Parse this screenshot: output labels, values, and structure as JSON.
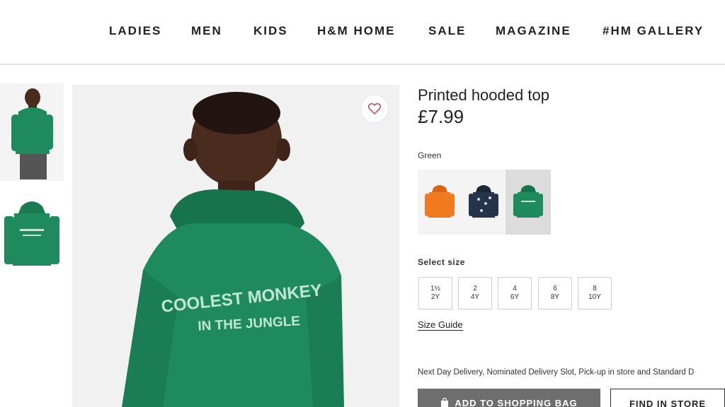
{
  "nav": {
    "items": [
      {
        "label": "LADIES"
      },
      {
        "label": "MEN"
      },
      {
        "label": "KIDS"
      },
      {
        "label": "H&M HOME"
      },
      {
        "label": "SALE"
      },
      {
        "label": "MAGAZINE"
      },
      {
        "label": "#HM GALLERY"
      }
    ]
  },
  "product": {
    "title": "Printed hooded top",
    "price": "£7.99",
    "color_label": "Green",
    "print_text_line1": "COOLEST MONKEY",
    "print_text_line2": "IN THE JUNGLE",
    "swatches": [
      {
        "color": "#f07a1f",
        "icon": "orange-hoodie-icon"
      },
      {
        "color": "#25344a",
        "icon": "navy-patterned-hoodie-icon"
      },
      {
        "color": "#1f8a5e",
        "icon": "green-hoodie-icon",
        "selected": true
      }
    ],
    "size_label": "Select size",
    "sizes": [
      {
        "top": "1½",
        "bottom": "2Y"
      },
      {
        "top": "2",
        "bottom": "4Y"
      },
      {
        "top": "4",
        "bottom": "6Y"
      },
      {
        "top": "6",
        "bottom": "8Y"
      },
      {
        "top": "8",
        "bottom": "10Y"
      }
    ],
    "size_guide": "Size Guide",
    "delivery_text": "Next Day Delivery, Nominated Delivery Slot, Pick-up in store and Standard D",
    "add_to_bag": "ADD TO SHOPPING BAG",
    "find_in_store": "FIND IN STORE"
  },
  "colors": {
    "hoodie_green": "#1f8a5e",
    "print_color": "#bfe6d6",
    "button_grey": "#6e6e6e"
  }
}
